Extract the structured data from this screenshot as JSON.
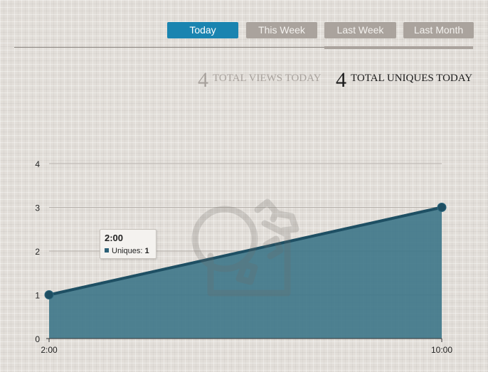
{
  "tabs": [
    {
      "label": "Today",
      "active": true
    },
    {
      "label": "This Week",
      "active": false
    },
    {
      "label": "Last Week",
      "active": false
    },
    {
      "label": "Last Month",
      "active": false
    }
  ],
  "stats": {
    "views": {
      "value": "4",
      "label": "TOTAL VIEWS TODAY"
    },
    "uniques": {
      "value": "4",
      "label": "TOTAL UNIQUES TODAY"
    }
  },
  "tooltip": {
    "time": "2:00",
    "series_label": "Uniques:",
    "value": "1"
  },
  "watermark_icon": "carrot-logo-icon",
  "colors": {
    "accent": "#1a84b0",
    "tab_inactive": "#aaa39d",
    "area_fill": "#40778a",
    "line": "#1e4f63"
  },
  "chart_data": {
    "type": "area",
    "x": [
      "2:00",
      "10:00"
    ],
    "series": [
      {
        "name": "Uniques",
        "values": [
          1,
          3
        ]
      }
    ],
    "xlabel": "",
    "ylabel": "",
    "ylim": [
      0,
      4
    ],
    "yticks": [
      0,
      1,
      2,
      3,
      4
    ],
    "xticks": [
      "2:00",
      "10:00"
    ],
    "grid": true,
    "legend": "none"
  }
}
